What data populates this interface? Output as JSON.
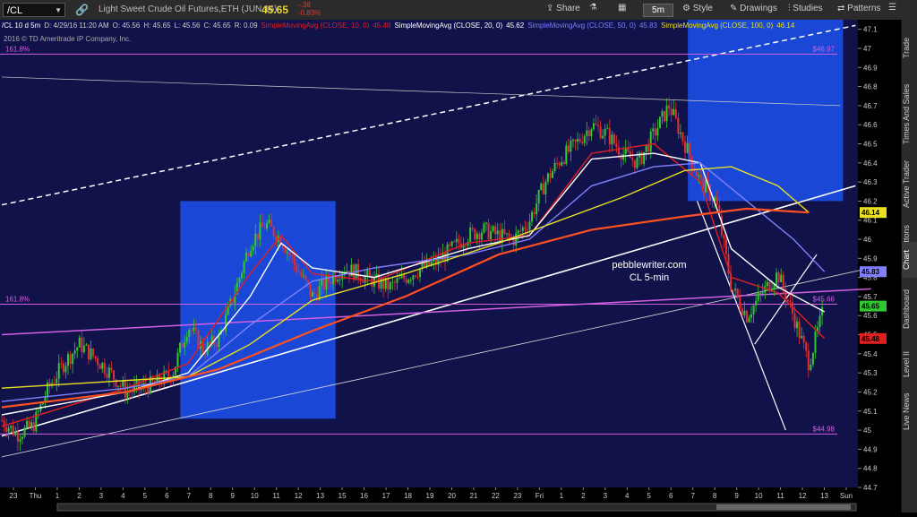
{
  "toolbar": {
    "symbol": "/CL",
    "description": "Light Sweet Crude Oil Futures,ETH (JUN 16)",
    "last": "45.65",
    "change": "-.38",
    "change_pct": "-0.83%",
    "share": "Share",
    "timeframe": "5m",
    "style": "Style",
    "drawings": "Drawings",
    "studies": "Studies",
    "patterns": "Patterns"
  },
  "header": {
    "period": "/CL 10 d 5m",
    "date": "D: 4/29/16 11:20 AM",
    "open": "O: 45.56",
    "high": "H: 45.65",
    "low": "L: 45.56",
    "close": "C: 45.65",
    "range": "R: 0.09",
    "sma10": "SimpleMovingAvg (CLOSE, 10, 0)",
    "sma10_val": "45.48",
    "sma20": "SimpleMovingAvg (CLOSE, 20, 0)",
    "sma20_val": "45.62",
    "sma50": "SimpleMovingAvg (CLOSE, 50, 0)",
    "sma50_val": "45.83",
    "sma100": "SimpleMovingAvg (CLOSE, 100, 0)",
    "sma100_val": "46.14",
    "copyright": "2016 © TD Ameritrade IP Company, Inc."
  },
  "side_tabs": [
    "Trade",
    "Times And Sales",
    "Active Trader",
    "Big Buttons",
    "Chart",
    "Dashboard",
    "Level II",
    "Live News"
  ],
  "colors": {
    "background": "#12124a",
    "up": "#32c832",
    "down": "#e03030",
    "sma10": "#e02020",
    "sma20": "#ffffff",
    "sma50": "#8080ff",
    "sma100": "#e8e020",
    "fib": "#d060e0",
    "box": "#1c4ee6"
  },
  "annotations": {
    "watermark_1": "pebblewriter.com",
    "watermark_2": "CL 5-min",
    "fib_top_label": "161.8%",
    "fib_top_value": "$46.97",
    "fib_mid_label": "161.8%",
    "fib_mid_value": "$45.66",
    "fib_low_value": "$44.98"
  },
  "chart_data": {
    "type": "candlestick",
    "ylim": [
      44.7,
      47.15
    ],
    "yticks": [
      "47.1",
      "47",
      "46.9",
      "46.8",
      "46.7",
      "46.6",
      "46.5",
      "46.4",
      "46.3",
      "46.2",
      "46.1",
      "46",
      "45.9",
      "45.8",
      "45.7",
      "45.6",
      "45.5",
      "45.4",
      "45.3",
      "45.2",
      "45.1",
      "45",
      "44.9",
      "44.8",
      "44.7"
    ],
    "xticks": [
      "23",
      "Thu",
      "1",
      "2",
      "3",
      "4",
      "5",
      "6",
      "7",
      "8",
      "9",
      "10",
      "11",
      "12",
      "13",
      "15",
      "16",
      "17",
      "18",
      "19",
      "20",
      "21",
      "22",
      "23",
      "Fri",
      "1",
      "2",
      "3",
      "4",
      "5",
      "6",
      "7",
      "8",
      "9",
      "10",
      "11",
      "12",
      "13",
      "Sun"
    ],
    "price_badges": [
      {
        "label": "45.83",
        "value": 45.83,
        "color": "#8080ff"
      },
      {
        "label": "46.14",
        "value": 46.14,
        "color": "#e8e020"
      },
      {
        "label": "45.65",
        "value": 45.65,
        "color": "#32c832"
      },
      {
        "label": "45.48",
        "value": 45.48,
        "color": "#e02020"
      }
    ],
    "last_close": 45.65,
    "close_path": [
      [
        0,
        45.05
      ],
      [
        1,
        44.98
      ],
      [
        2,
        45.02
      ],
      [
        3,
        45.22
      ],
      [
        4,
        45.35
      ],
      [
        5,
        45.45
      ],
      [
        6,
        45.38
      ],
      [
        7,
        45.3
      ],
      [
        8,
        45.2
      ],
      [
        9,
        45.22
      ],
      [
        10,
        45.25
      ],
      [
        11,
        45.3
      ],
      [
        12,
        45.55
      ],
      [
        13,
        45.42
      ],
      [
        14,
        45.48
      ],
      [
        15,
        45.72
      ],
      [
        16,
        45.98
      ],
      [
        17,
        46.08
      ],
      [
        18,
        46.0
      ],
      [
        19,
        45.85
      ],
      [
        20,
        45.7
      ],
      [
        21,
        45.78
      ],
      [
        22,
        45.85
      ],
      [
        23,
        45.82
      ],
      [
        24,
        45.78
      ],
      [
        25,
        45.75
      ],
      [
        26,
        45.8
      ],
      [
        27,
        45.85
      ],
      [
        28,
        45.88
      ],
      [
        29,
        45.95
      ],
      [
        30,
        46.02
      ],
      [
        31,
        46.05
      ],
      [
        32,
        46.02
      ],
      [
        33,
        46.0
      ],
      [
        34,
        46.1
      ],
      [
        35,
        46.3
      ],
      [
        36,
        46.42
      ],
      [
        37,
        46.5
      ],
      [
        38,
        46.6
      ],
      [
        39,
        46.55
      ],
      [
        40,
        46.45
      ],
      [
        41,
        46.4
      ],
      [
        42,
        46.55
      ],
      [
        43,
        46.7
      ],
      [
        44,
        46.5
      ],
      [
        45,
        46.3
      ],
      [
        46,
        46.2
      ],
      [
        47,
        45.75
      ],
      [
        48,
        45.6
      ],
      [
        49,
        45.72
      ],
      [
        50,
        45.82
      ],
      [
        51,
        45.6
      ],
      [
        52,
        45.35
      ],
      [
        53,
        45.65
      ]
    ],
    "sma": [
      {
        "name": "SimpleMovingAvg (CLOSE, 10, 0)",
        "color": "#e02020",
        "points": [
          [
            0,
            45.02
          ],
          [
            8,
            45.22
          ],
          [
            12,
            45.35
          ],
          [
            16,
            45.82
          ],
          [
            18,
            46.02
          ],
          [
            20,
            45.82
          ],
          [
            24,
            45.78
          ],
          [
            30,
            45.98
          ],
          [
            34,
            46.02
          ],
          [
            38,
            46.45
          ],
          [
            42,
            46.5
          ],
          [
            45,
            46.3
          ],
          [
            47,
            45.8
          ],
          [
            50,
            45.72
          ],
          [
            53,
            45.48
          ]
        ]
      },
      {
        "name": "SimpleMovingAvg (CLOSE, 20, 0)",
        "color": "#ffffff",
        "points": [
          [
            0,
            45.08
          ],
          [
            8,
            45.2
          ],
          [
            12,
            45.3
          ],
          [
            16,
            45.7
          ],
          [
            18,
            45.98
          ],
          [
            20,
            45.85
          ],
          [
            24,
            45.8
          ],
          [
            30,
            45.95
          ],
          [
            34,
            46.02
          ],
          [
            38,
            46.42
          ],
          [
            42,
            46.45
          ],
          [
            45,
            46.4
          ],
          [
            47,
            45.95
          ],
          [
            50,
            45.75
          ],
          [
            53,
            45.62
          ]
        ]
      },
      {
        "name": "SimpleMovingAvg (CLOSE, 50, 0)",
        "color": "#8080ff",
        "points": [
          [
            0,
            45.15
          ],
          [
            8,
            45.22
          ],
          [
            12,
            45.28
          ],
          [
            16,
            45.55
          ],
          [
            20,
            45.78
          ],
          [
            24,
            45.85
          ],
          [
            30,
            45.92
          ],
          [
            34,
            46.0
          ],
          [
            38,
            46.28
          ],
          [
            42,
            46.38
          ],
          [
            45,
            46.4
          ],
          [
            48,
            46.2
          ],
          [
            51,
            46.0
          ],
          [
            53,
            45.83
          ]
        ]
      },
      {
        "name": "SimpleMovingAvg (CLOSE, 100, 0)",
        "color": "#e8e020",
        "points": [
          [
            0,
            45.22
          ],
          [
            6,
            45.25
          ],
          [
            12,
            45.28
          ],
          [
            16,
            45.45
          ],
          [
            20,
            45.68
          ],
          [
            26,
            45.82
          ],
          [
            32,
            45.98
          ],
          [
            36,
            46.1
          ],
          [
            40,
            46.22
          ],
          [
            44,
            46.36
          ],
          [
            47,
            46.38
          ],
          [
            50,
            46.28
          ],
          [
            52,
            46.14
          ]
        ]
      },
      {
        "name": "orange",
        "color": "#ff5020",
        "points": [
          [
            0,
            45.12
          ],
          [
            8,
            45.2
          ],
          [
            14,
            45.32
          ],
          [
            20,
            45.52
          ],
          [
            26,
            45.7
          ],
          [
            32,
            45.92
          ],
          [
            38,
            46.05
          ],
          [
            44,
            46.12
          ],
          [
            48,
            46.16
          ],
          [
            52,
            46.14
          ]
        ]
      }
    ],
    "boxes": [
      {
        "x0": 11.5,
        "x1": 21.5,
        "y0": 45.06,
        "y1": 46.2
      },
      {
        "x0": 44.2,
        "x1": 54.2,
        "y0": 46.2,
        "y1": 47.15
      }
    ],
    "fib_levels": [
      46.97,
      45.66,
      44.98
    ]
  }
}
